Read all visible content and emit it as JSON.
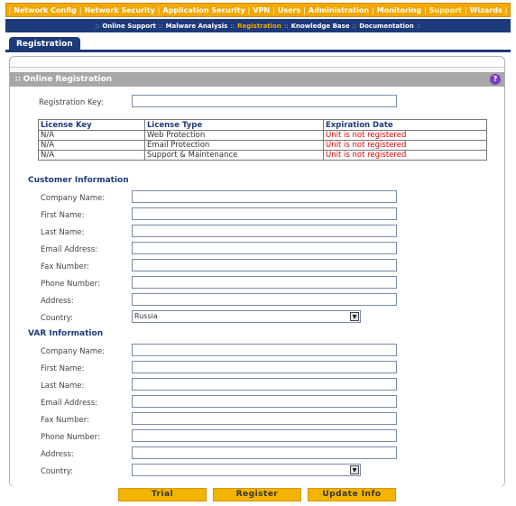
{
  "topnav": {
    "items": [
      "Network Config",
      "Network Security",
      "Application Security",
      "VPN",
      "Users",
      "Administration",
      "Monitoring",
      "Support",
      "Wizards"
    ],
    "active": "Support"
  },
  "subnav": {
    "items": [
      "Online Support",
      "Malware Analysis",
      "Registration",
      "Knowledge Base",
      "Documentation"
    ],
    "active": "Registration"
  },
  "tab": {
    "label": "Registration"
  },
  "section": {
    "title": "Online Registration",
    "help_symbol": "?"
  },
  "registration_key": {
    "label": "Registration Key:",
    "value": ""
  },
  "license_table": {
    "headers": [
      "License Key",
      "License Type",
      "Expiration Date"
    ],
    "rows": [
      [
        "N/A",
        "Web Protection",
        "Unit is not registered"
      ],
      [
        "N/A",
        "Email Protection",
        "Unit is not registered"
      ],
      [
        "N/A",
        "Support & Maintenance",
        "Unit is not registered"
      ]
    ]
  },
  "customer": {
    "title": "Customer Information",
    "company": {
      "label": "Company Name:",
      "value": ""
    },
    "first": {
      "label": "First Name:",
      "value": ""
    },
    "last": {
      "label": "Last Name:",
      "value": ""
    },
    "email": {
      "label": "Email Address:",
      "value": ""
    },
    "fax": {
      "label": "Fax Number:",
      "value": ""
    },
    "phone": {
      "label": "Phone Number:",
      "value": ""
    },
    "address": {
      "label": "Address:",
      "value": ""
    },
    "country": {
      "label": "Country:",
      "value": "Russia"
    }
  },
  "var": {
    "title": "VAR Information",
    "company": {
      "label": "Company Name:",
      "value": ""
    },
    "first": {
      "label": "First Name:",
      "value": ""
    },
    "last": {
      "label": "Last Name:",
      "value": ""
    },
    "email": {
      "label": "Email Address:",
      "value": ""
    },
    "fax": {
      "label": "Fax Number:",
      "value": ""
    },
    "phone": {
      "label": "Phone Number:",
      "value": ""
    },
    "address": {
      "label": "Address:",
      "value": ""
    },
    "country": {
      "label": "Country:",
      "value": ""
    }
  },
  "buttons": {
    "trial": "Trial",
    "register": "Register",
    "update": "Update Info"
  },
  "colors": {
    "nav_orange": "#f2a800",
    "nav_blue": "#1d3a7a",
    "error_red": "#dd0000",
    "button_yellow": "#f2b400"
  }
}
